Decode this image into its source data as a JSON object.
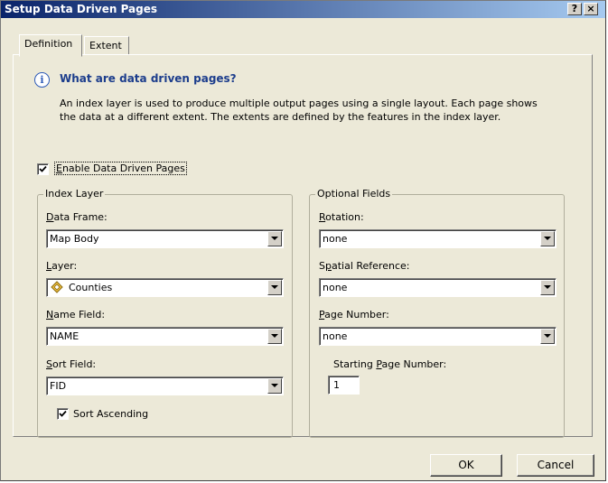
{
  "window": {
    "title": "Setup Data Driven Pages",
    "help_label": "?",
    "close_label": "×"
  },
  "tabs": [
    {
      "label": "Definition"
    },
    {
      "label": "Extent"
    }
  ],
  "info": {
    "title": "What are data driven pages?",
    "line1": "An index layer is used to produce multiple output pages using a single layout.   Each page shows",
    "line2": "the data at a different extent.  The extents are defined by the features in the index layer."
  },
  "enable": {
    "prefix": "E",
    "rest": "nable Data Driven Pages",
    "checked": true
  },
  "index_layer": {
    "title": "Index Layer",
    "data_frame": {
      "label_u": "D",
      "label_rest": "ata Frame:",
      "value": "Map Body"
    },
    "layer": {
      "label_u": "L",
      "label_rest": "ayer:",
      "value": "Counties"
    },
    "name_field": {
      "label_u": "N",
      "label_rest": "ame Field:",
      "value": "NAME"
    },
    "sort_field": {
      "label_u": "S",
      "label_rest": "ort Field:",
      "value": "FID"
    },
    "sort_ascending": {
      "label": "Sort Ascending",
      "checked": true
    }
  },
  "optional_fields": {
    "title": "Optional Fields",
    "rotation": {
      "label_u": "R",
      "label_rest": "otation:",
      "value": "none"
    },
    "spatial_reference": {
      "label_pre": "S",
      "label_u": "p",
      "label_rest": "atial Reference:",
      "value": "none"
    },
    "page_number": {
      "label_u": "P",
      "label_rest": "age Number:",
      "value": "none"
    },
    "starting_page": {
      "label_pre": "Starting ",
      "label_u": "P",
      "label_rest": "age Number:",
      "value": "1"
    }
  },
  "buttons": {
    "ok": "OK",
    "cancel": "Cancel"
  },
  "colors": {
    "title_start": "#0a246a",
    "title_end": "#a6caf0",
    "info_title": "#1c3d8c",
    "face": "#ece9d8"
  }
}
